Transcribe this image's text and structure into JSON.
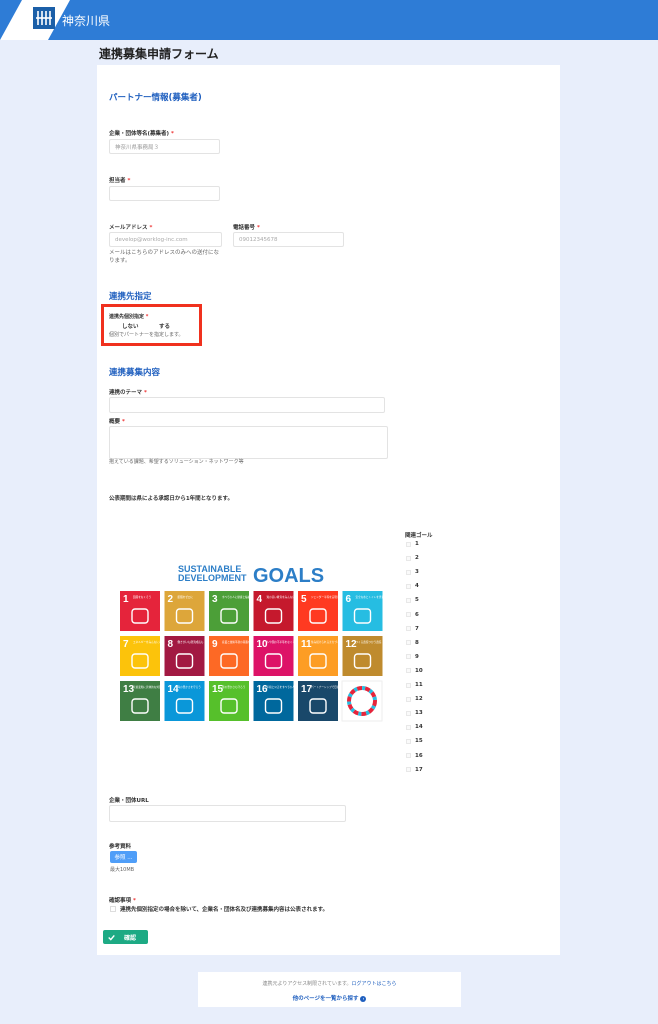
{
  "header": {
    "title": "神奈川県",
    "logo_subtext": "KANAGAWA"
  },
  "page_title": "連携募集申請フォーム",
  "partner_section": {
    "title": "パートナー情報(募集者)",
    "company": {
      "label": "企業・団体等名(募集者)",
      "required": "*",
      "value": "神奈川県事務局３"
    },
    "person": {
      "label": "担当者",
      "required": "*",
      "value": ""
    },
    "email": {
      "label": "メールアドレス",
      "required": "*",
      "placeholder": "develop@worklog-inc.com",
      "help_line1": "メールはこちらのアドレスのみへの送付にな",
      "help_line2": "ります。"
    },
    "phone": {
      "label": "電話番号",
      "required": "*",
      "placeholder": "09012345678"
    }
  },
  "target_section": {
    "title": "連携先指定",
    "label": "連携先個別指定",
    "required": "*",
    "option_no": "しない",
    "option_yes": "する",
    "help": "個別でパートナーを指定します。"
  },
  "content_section": {
    "title": "連携募集内容",
    "theme": {
      "label": "連携のテーマ",
      "required": "*"
    },
    "summary": {
      "label": "概要",
      "required": "*",
      "help": "抱えている課題、希望するソリューション・ネットワーク等"
    },
    "period_note": "公表期間は県による承認日から1年間となります。"
  },
  "sdgs": {
    "title_line1": "SUSTAINABLE",
    "title_line2": "DEVELOPMENT",
    "title_goals": "GOALS",
    "goals_label": "関連ゴール",
    "goal_numbers": [
      "1",
      "2",
      "3",
      "4",
      "5",
      "6",
      "7",
      "8",
      "9",
      "10",
      "11",
      "12",
      "13",
      "14",
      "15",
      "16",
      "17"
    ],
    "tile_colors": [
      "#e5243b",
      "#dda63a",
      "#4c9f38",
      "#c5192d",
      "#ff3a21",
      "#26bde2",
      "#fcc30b",
      "#a21942",
      "#fd6925",
      "#dd1367",
      "#fd9d24",
      "#bf8b2e",
      "#3f7e44",
      "#0a97d9",
      "#56c02b",
      "#00689d",
      "#19486a"
    ],
    "tile_labels": [
      "貧困をなくそう",
      "飢餓をゼロに",
      "すべての人に健康と福祉を",
      "質の高い教育をみんなに",
      "ジェンダー平等を実現しよう",
      "安全な水とトイレを世界中に",
      "エネルギーをみんなにそしてクリーンに",
      "働きがいも経済成長も",
      "産業と技術革新の基盤をつくろう",
      "人や国の不平等をなくそう",
      "住み続けられるまちづくりを",
      "つくる責任つかう責任",
      "気候変動に具体的な対策を",
      "海の豊かさを守ろう",
      "陸の豊かさも守ろう",
      "平和と公正をすべての人に",
      "パートナーシップで目標を達成しよう"
    ]
  },
  "url_field": {
    "label": "企業・団体URL"
  },
  "reference": {
    "label": "参考資料",
    "button": "参照 ...",
    "max": "最大10MB"
  },
  "confirm": {
    "label": "確認事項",
    "required": "*",
    "text": "連携先個別指定の場合を除いて、企業名・団体名及び連携募集内容は公表されます。"
  },
  "confirm_button": {
    "label": "確認"
  },
  "footer": {
    "note": "連携元よりアクセス制限されています。",
    "logout": "ログアウトはこちら",
    "link": "他のページを一覧から探す"
  },
  "colors": {
    "header": "#2e7cd6",
    "accent": "#1f5fbf",
    "confirm": "#1daa84",
    "highlight": "#f0311e"
  }
}
